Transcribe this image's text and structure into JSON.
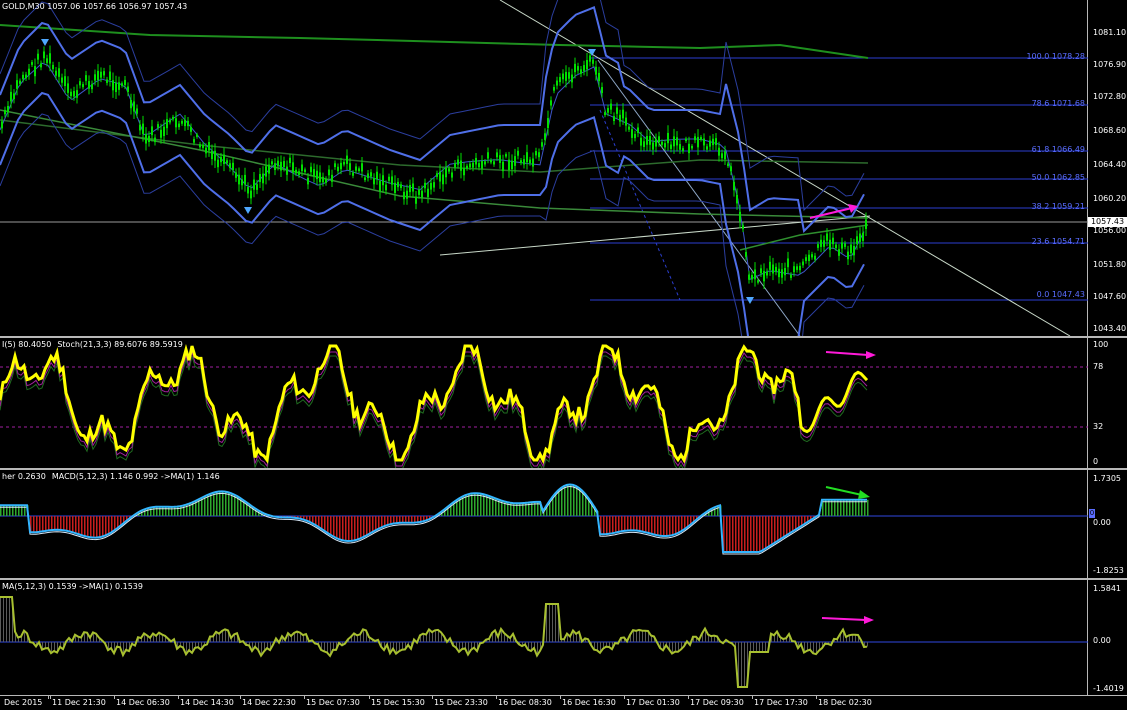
{
  "main": {
    "header": "GOLD,M30  1057.06 1057.66 1056.97 1057.43",
    "yticks": [
      "1081.10",
      "1076.90",
      "1072.80",
      "1068.60",
      "1064.40",
      "1060.20",
      "1056.00",
      "1051.80",
      "1047.60",
      "1043.40"
    ],
    "current_price": "1057.43",
    "fib_levels": [
      {
        "label": "100.0 1078.28"
      },
      {
        "label": "78.6 1071.68"
      },
      {
        "label": "61.8 1066.49"
      },
      {
        "label": "50.0 1062.85"
      },
      {
        "label": "38.2 1059.21"
      },
      {
        "label": "23.6 1054.71"
      },
      {
        "label": "0.0 1047.43"
      }
    ]
  },
  "stoch": {
    "header_left": "I(5) 80.4050",
    "header_right": "Stoch(21,3,3) 89.6076 89.5919",
    "yticks": [
      "100",
      "78",
      "32",
      "0"
    ]
  },
  "macd": {
    "header_left": "her 0.2630",
    "header_right": "MACD(5,12,3) 1.146 0.992  ->MA(1) 1.146",
    "yticks": [
      "1.7305",
      "0.00",
      "-1.8253"
    ],
    "level_marker": "0"
  },
  "osma": {
    "header": "MA(5,12,3) 0.1539  ->MA(1) 0.1539",
    "yticks": [
      "1.5841",
      "0.00",
      "-1.4019"
    ]
  },
  "xaxis": {
    "labels": [
      "Dec 2015",
      "11 Dec 21:30",
      "14 Dec 06:30",
      "14 Dec 14:30",
      "14 Dec 22:30",
      "15 Dec 07:30",
      "15 Dec 15:30",
      "15 Dec 23:30",
      "16 Dec 08:30",
      "16 Dec 16:30",
      "17 Dec 01:30",
      "17 Dec 09:30",
      "17 Dec 17:30",
      "18 Dec 02:30"
    ]
  },
  "colors": {
    "candle": "#00e000",
    "bands": "#4f6fe8",
    "bands_thin": "#2b3e9e",
    "ma_green": "#1e8f1e",
    "stoch_main": "#ffff00",
    "macd_hist_pos": "#2ea82e",
    "macd_hist_neg": "#c81e1e",
    "macd_line": "#33b5ff",
    "osma_line": "#a8c030",
    "arrow_magenta": "#ff1ad9",
    "arrow_green": "#22dd22"
  }
}
